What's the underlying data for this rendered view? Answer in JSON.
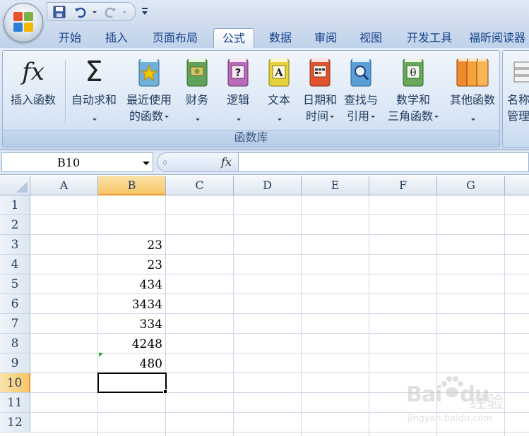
{
  "tabs": [
    {
      "label": "开始",
      "active": false
    },
    {
      "label": "插入",
      "active": false
    },
    {
      "label": "页面布局",
      "active": false
    },
    {
      "label": "公式",
      "active": true
    },
    {
      "label": "数据",
      "active": false
    },
    {
      "label": "审阅",
      "active": false
    },
    {
      "label": "视图",
      "active": false
    },
    {
      "label": "开发工具",
      "active": false
    },
    {
      "label": "福昕阅读器",
      "active": false
    }
  ],
  "ribbon": {
    "group_label": "函数库",
    "buttons": [
      {
        "name": "insert-function",
        "line1": "插入函数",
        "line2": "",
        "icon": "fx-icon"
      },
      {
        "name": "autosum",
        "line1": "自动求和",
        "line2": "",
        "icon": "sigma-icon"
      },
      {
        "name": "recently-used",
        "line1": "最近使用",
        "line2": "的函数",
        "icon": "star-book-icon"
      },
      {
        "name": "financial",
        "line1": "财务",
        "line2": "",
        "icon": "money-book-icon"
      },
      {
        "name": "logical",
        "line1": "逻辑",
        "line2": "",
        "icon": "question-book-icon"
      },
      {
        "name": "text",
        "line1": "文本",
        "line2": "",
        "icon": "text-book-icon"
      },
      {
        "name": "date-time",
        "line1": "日期和",
        "line2": "时间",
        "icon": "calendar-book-icon"
      },
      {
        "name": "lookup-reference",
        "line1": "查找与",
        "line2": "引用",
        "icon": "magnifier-book-icon"
      },
      {
        "name": "math-trig",
        "line1": "数学和",
        "line2": "三角函数",
        "icon": "theta-book-icon"
      },
      {
        "name": "more-functions",
        "line1": "其他函数",
        "line2": "",
        "icon": "books-icon"
      }
    ],
    "name_manager": {
      "line1": "名称",
      "line2": "管理"
    },
    "fx_glyph": "fx",
    "sigma_glyph": "Σ",
    "question_glyph": "?",
    "text_glyph": "A",
    "theta_glyph": "θ"
  },
  "formula_bar": {
    "name_box": "B10",
    "fx_label": "fx",
    "formula": ""
  },
  "sheet": {
    "columns": [
      "A",
      "B",
      "C",
      "D",
      "E",
      "F",
      "G"
    ],
    "rows": [
      "1",
      "2",
      "3",
      "4",
      "5",
      "6",
      "7",
      "8",
      "9",
      "10",
      "11",
      "12"
    ],
    "selected_column": "B",
    "selected_row": "10",
    "column_b_values": [
      {
        "row": "3",
        "value": "23"
      },
      {
        "row": "4",
        "value": "23"
      },
      {
        "row": "5",
        "value": "434"
      },
      {
        "row": "6",
        "value": "3434"
      },
      {
        "row": "7",
        "value": "334"
      },
      {
        "row": "8",
        "value": "4248"
      },
      {
        "row": "9",
        "value": "480"
      }
    ]
  },
  "watermark": {
    "logo": "Bai",
    "logo_tail": "du",
    "cn": "经验",
    "url": "jingyan.baidu.com"
  }
}
